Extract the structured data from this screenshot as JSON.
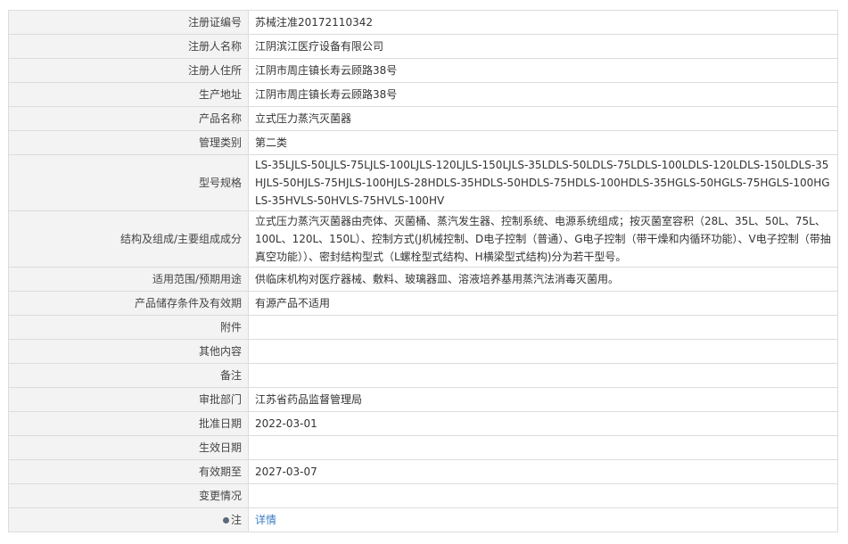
{
  "rows": [
    {
      "label": "注册证编号",
      "value": "苏械注准20172110342"
    },
    {
      "label": "注册人名称",
      "value": "江阴滨江医疗设备有限公司"
    },
    {
      "label": "注册人住所",
      "value": "江阴市周庄镇长寿云顾路38号"
    },
    {
      "label": "生产地址",
      "value": "江阴市周庄镇长寿云顾路38号"
    },
    {
      "label": "产品名称",
      "value": "立式压力蒸汽灭菌器"
    },
    {
      "label": "管理类别",
      "value": "第二类"
    },
    {
      "label": "型号规格",
      "value": "LS-35LJLS-50LJLS-75LJLS-100LJLS-120LJLS-150LJLS-35LDLS-50LDLS-75LDLS-100LDLS-120LDLS-150LDLS-35HJLS-50HJLS-75HJLS-100HJLS-28HDLS-35HDLS-50HDLS-75HDLS-100HDLS-35HGLS-50HGLS-75HGLS-100HGLS-35HVLS-50HVLS-75HVLS-100HV"
    },
    {
      "label": "结构及组成/主要组成成分",
      "value": "立式压力蒸汽灭菌器由壳体、灭菌桶、蒸汽发生器、控制系统、电源系统组成；按灭菌室容积（28L、35L、50L、75L、100L、120L、150L）、控制方式(J机械控制、D电子控制（普通）、G电子控制（带干燥和内循环功能）、V电子控制（带抽真空功能））、密封结构型式（L螺栓型式结构、H横梁型式结构)分为若干型号。"
    },
    {
      "label": "适用范围/预期用途",
      "value": "供临床机构对医疗器械、敷料、玻璃器皿、溶液培养基用蒸汽法消毒灭菌用。"
    },
    {
      "label": "产品储存条件及有效期",
      "value": "有源产品不适用"
    },
    {
      "label": "附件",
      "value": ""
    },
    {
      "label": "其他内容",
      "value": ""
    },
    {
      "label": "备注",
      "value": ""
    },
    {
      "label": "审批部门",
      "value": "江苏省药品监督管理局"
    },
    {
      "label": "批准日期",
      "value": "2022-03-01"
    },
    {
      "label": "生效日期",
      "value": ""
    },
    {
      "label": "有效期至",
      "value": "2027-03-07"
    },
    {
      "label": "变更情况",
      "value": ""
    }
  ],
  "note": {
    "label": "注",
    "link": "详情",
    "icon": "dot-icon"
  }
}
